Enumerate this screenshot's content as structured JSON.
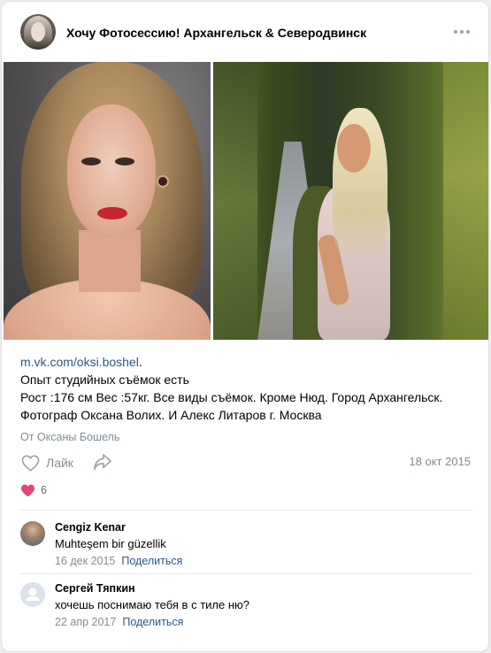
{
  "post": {
    "group_name": "Хочу Фотосессию! Архангельск & Северодвинск",
    "menu_icon": "more-horizontal-icon",
    "text": {
      "link": "m.vk.com/oksi.boshel",
      "link_suffix": ".",
      "lines": [
        "Опыт студийных съёмок есть",
        "Рост :176 см Вес :57кг. Все виды съёмок. Кроме Нюд. Город Архангельск.",
        "Фотограф Оксана Волих. И Алекс Литаров г. Москва"
      ]
    },
    "signature": "От Оксаны Бошель",
    "like_label": "Лайк",
    "date": "18 окт 2015",
    "reactions_count": "6"
  },
  "comments": [
    {
      "author": "Cengiz Kenar",
      "text": "Muhteşem bir güzellik",
      "date": "16 дек 2015",
      "share_label": "Поделиться"
    },
    {
      "author": "Сергей Тяпкин",
      "text": "хочешь поснимаю тебя в с тиле ню?",
      "date": "22 апр 2017",
      "share_label": "Поделиться"
    }
  ],
  "colors": {
    "link": "#2a5885",
    "secondary_text": "#818c99",
    "heart": "#e6457a",
    "background": "#edeef0"
  }
}
